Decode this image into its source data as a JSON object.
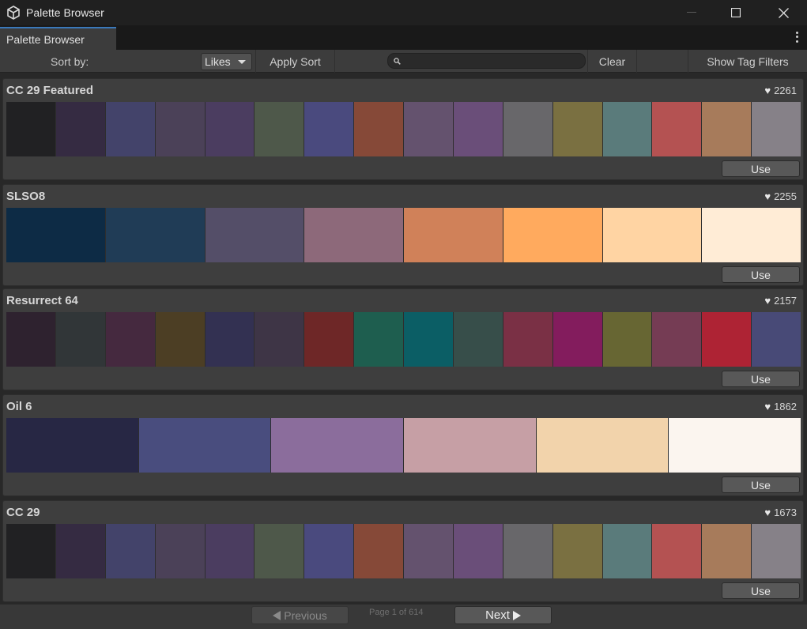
{
  "window": {
    "title": "Palette Browser",
    "icon": "unity-cube-icon"
  },
  "tab": {
    "label": "Palette Browser"
  },
  "toolbar": {
    "sort_label": "Sort by:",
    "sort_value": "Likes",
    "apply_sort": "Apply Sort",
    "search_placeholder": "",
    "clear": "Clear",
    "show_tag_filters": "Show Tag Filters"
  },
  "palettes": [
    {
      "name": "CC 29 Featured",
      "likes": "2261",
      "use_label": "Use",
      "colors": [
        "#212123",
        "#352b42",
        "#43436a",
        "#4b4158",
        "#4b3d60",
        "#4e584a",
        "#4a4a7e",
        "#864938",
        "#64526e",
        "#6a4e79",
        "#68676a",
        "#7a7041",
        "#5a7b7b",
        "#b45252",
        "#a77b5b",
        "#868188"
      ]
    },
    {
      "name": "SLSO8",
      "likes": "2255",
      "use_label": "Use",
      "colors": [
        "#0d2b45",
        "#203c56",
        "#544e68",
        "#8d697a",
        "#d08159",
        "#ffaa5e",
        "#ffd4a3",
        "#ffecd6"
      ]
    },
    {
      "name": "Resurrect 64",
      "likes": "2157",
      "use_label": "Use",
      "colors": [
        "#2e222f",
        "#313638",
        "#45293f",
        "#4c3e24",
        "#333152",
        "#3e3546",
        "#6e2727",
        "#1e5e4f",
        "#0b5e65",
        "#374e4a",
        "#7a3045",
        "#831c5d",
        "#676633",
        "#753c54",
        "#ae2334",
        "#484a77"
      ]
    },
    {
      "name": "Oil 6",
      "likes": "1862",
      "use_label": "Use",
      "colors": [
        "#272744",
        "#494d7e",
        "#8b6d9c",
        "#c69fa5",
        "#f2d3ab",
        "#fbf5ef"
      ]
    },
    {
      "name": "CC 29",
      "likes": "1673",
      "use_label": "Use",
      "colors": [
        "#212123",
        "#352b42",
        "#43436a",
        "#4b4158",
        "#4b3d60",
        "#4e584a",
        "#4a4a7e",
        "#864938",
        "#64526e",
        "#6a4e79",
        "#68676a",
        "#7a7041",
        "#5a7b7b",
        "#b45252",
        "#a77b5b",
        "#868188"
      ]
    }
  ],
  "pagination": {
    "previous": "Previous",
    "next": "Next",
    "page_info": "Page 1 of 614"
  }
}
